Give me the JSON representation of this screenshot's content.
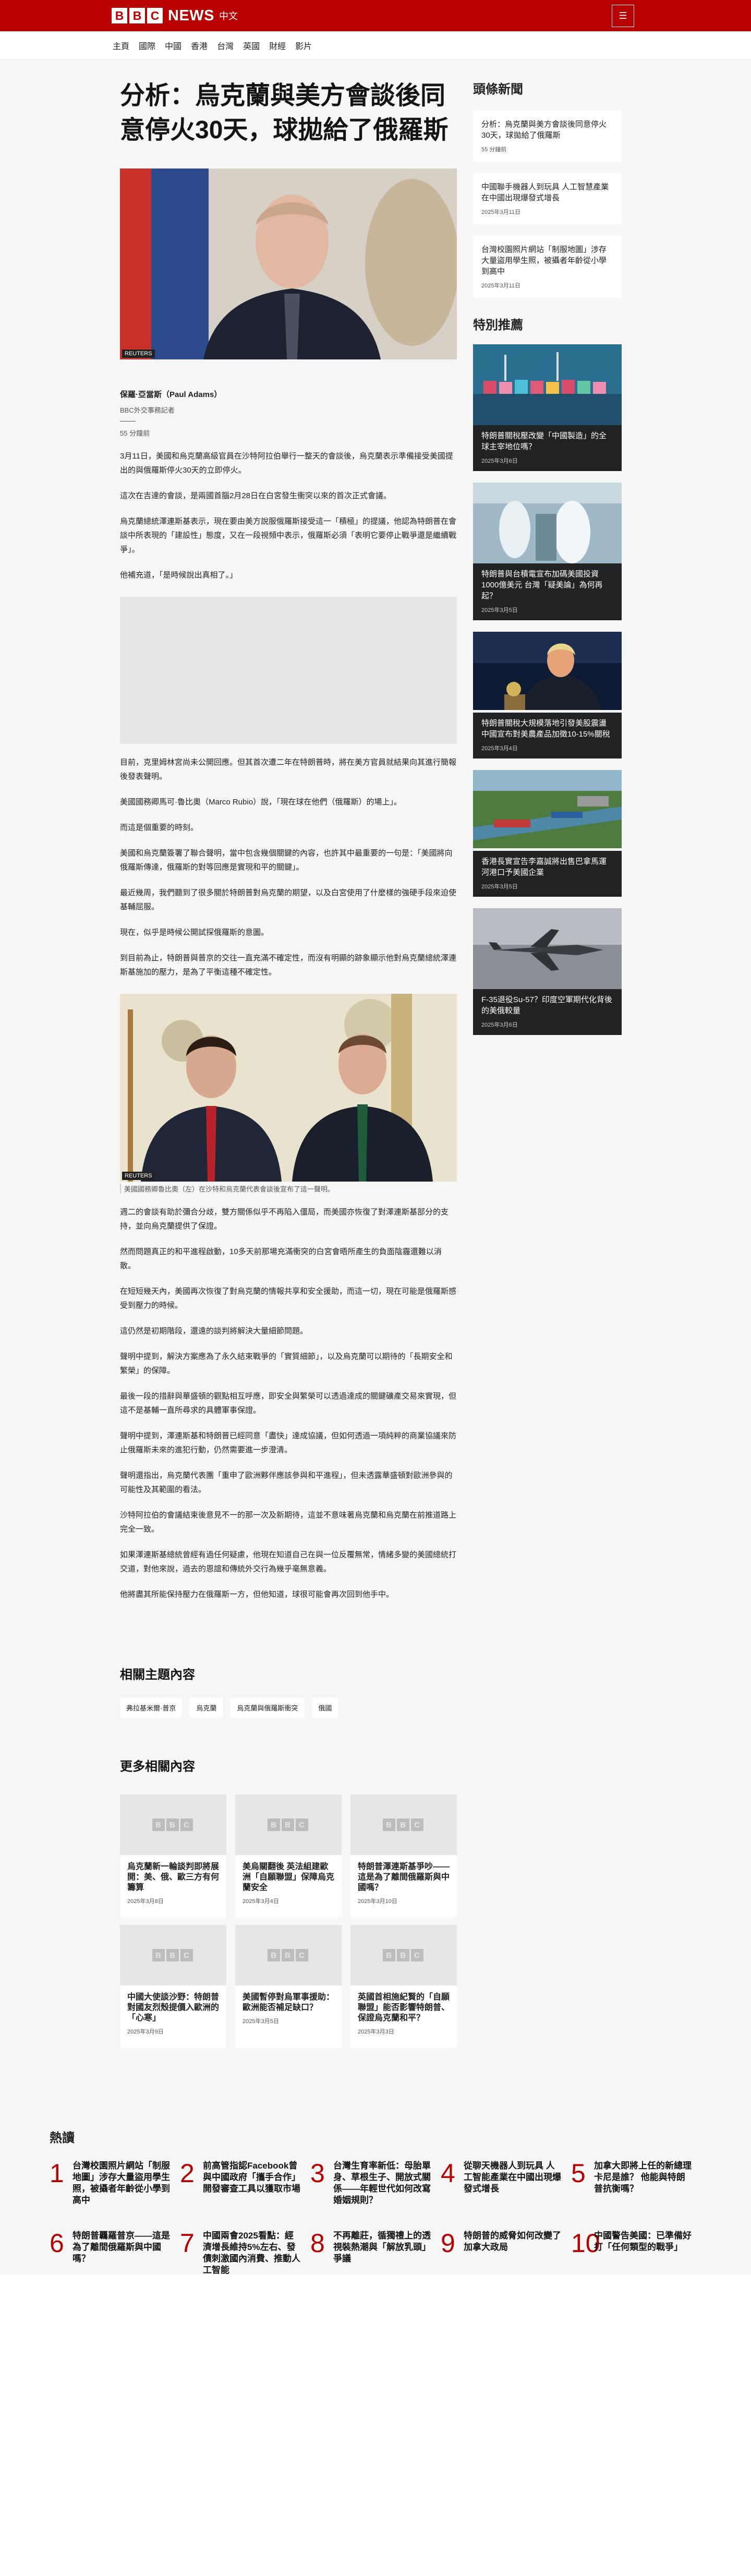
{
  "header": {
    "logo_letters": [
      "B",
      "B",
      "C"
    ],
    "logo_text": "NEWS",
    "logo_lang": "中文",
    "menu_icon": "hamburger-icon"
  },
  "nav": [
    "主頁",
    "國際",
    "中國",
    "香港",
    "台灣",
    "英國",
    "財經",
    "影片"
  ],
  "article": {
    "headline": "分析：烏克蘭與美方會談後同意停火30天，球拋給了俄羅斯",
    "hero_credit": "REUTERS",
    "author": "保羅·亞當斯（Paul Adams）",
    "author_role": "BBC外交事務記者",
    "read_time": "55 分鐘前",
    "paras_a": [
      "3月11日，美國和烏克蘭高級官員在沙特阿拉伯舉行一整天的會談後，烏克蘭表示準備接受美國提出的與俄羅斯停火30天的立即停火。",
      "這次在吉達的會談，是兩國首腦2月28日在白宮發生衝突以來的首次正式會議。",
      "烏克蘭總統澤連斯基表示，現在要由美方說服俄羅斯接受這一「積極」的提議，他認為特朗普在會談中所表現的「建設性」態度，又在一段視頻中表示，俄羅斯必須「表明它要停止戰爭還是繼續戰爭」。",
      "他補充道，「是時候說出真相了。」"
    ],
    "paras_b": [
      "目前，克里姆林宮尚未公開回應。但其首次遭二年在特朗普時，將在美方官員就結果向其進行簡報後發表聲明。",
      "美國國務卿馬可·魯比奧（Marco Rubio）說，「現在球在他們（俄羅斯）的場上」。",
      "而這是個重要的時刻。",
      "美國和烏克蘭簽署了聯合聲明，當中包含幾個關鍵的內容，也許其中最重要的一句是：「美國將向俄羅斯傳達，俄羅斯的對等回應是實現和平的關鍵」。",
      "最近幾周，我們聽到了很多關於特朗普對烏克蘭的期望，以及白宮使用了什麼樣的強硬手段來迫使基輔屈服。",
      "現在，似乎是時候公開試探俄羅斯的意圖。",
      "到目前為止，特朗普與普京的交往一直充滿不確定性，而沒有明顯的跡象顯示他對烏克蘭總統澤連斯基施加的壓力，是為了平衡這種不確定性。"
    ],
    "img2_credit": "REUTERS",
    "img2_caption": "美國國務卿魯比奧（左）在沙特和烏克蘭代表會談後宣布了這一聲明。",
    "paras_c": [
      "週二的會談有助於彌合分歧，雙方關係似乎不再陷入僵局，而美國亦恢復了對澤連斯基部分的支持，並向烏克蘭提供了保證。",
      "然而問題真正的和平進程啟動，10多天前那場充滿衝突的白宮會晤所產生的負面陰霾還難以消散。",
      "在短短幾天內，美國再次恢復了對烏克蘭的情報共享和安全援助，而這一切，現在可能是俄羅斯感受到壓力的時候。",
      "這仍然是初期階段，還遠的談判將解決大量細節問題。",
      "聲明中提到，解決方案應為了永久結束戰爭的「實質細節」，以及烏克蘭可以期待的「長期安全和繁榮」的保障。",
      "最後一段的措辭與華盛頓的觀點相互呼應，即安全與繁榮可以透過達成的關鍵礦產交易來實現，但這不是基輔一直所尋求的具體軍事保證。",
      "聲明中提到，澤連斯基和特朗普已經同意「盡快」達成協議，但如何透過一項純粹的商業協議來防止俄羅斯未來的進犯行動，仍然需要進一步澄清。",
      "聲明還指出，烏克蘭代表團「重申了歐洲夥伴應該參與和平進程」，但未透露華盛頓對歐洲參與的可能性及其範圍的看法。",
      "沙特阿拉伯的會議結束後意見不一的那一次及新期待，這並不意味著烏克蘭和烏克蘭在前推道路上完全一致。",
      "如果澤連斯基總統曾經有過任何疑慮，他現在知道自己在與一位反覆無常，情緒多變的美國總統打交道，對他來說，過去的恩誼和傳統外交行為幾乎毫無意義。",
      "他將盡其所能保持壓力在俄羅斯一方，但他知道，球很可能會再次回到他手中。"
    ]
  },
  "related_topics": {
    "heading": "相關主題內容",
    "tags": [
      "弗拉基米爾·普京",
      "烏克蘭",
      "烏克蘭與俄羅斯衝突",
      "俄國"
    ]
  },
  "more_related": {
    "heading": "更多相關內容",
    "placeholder_letters": [
      "B",
      "B",
      "C"
    ],
    "cards": [
      {
        "title": "烏克蘭新一輪談判即將展開：美、俄、歐三方有何籌算",
        "date": "2025年3月8日"
      },
      {
        "title": "美烏關翻後 英法組建歐洲「自願聯盟」保障烏克蘭安全",
        "date": "2025年3月4日"
      },
      {
        "title": "特朗普澤連斯基爭吵——這是為了離間俄羅斯與中國嗎？",
        "date": "2025年3月10日"
      },
      {
        "title": "中國大使談沙野：特朗普對國友烈殼提價入歐洲的「心寒」",
        "date": "2025年3月9日"
      },
      {
        "title": "美國暫停對烏軍事援助：歐洲能否補足缺口？",
        "date": "2025年3月5日"
      },
      {
        "title": "英國首相施紀賢的「自願聯盟」能否影響特朗普、保證烏克蘭和平？",
        "date": "2025年3月3日"
      }
    ]
  },
  "sidebar": {
    "headlines_heading": "頭條新聞",
    "headlines": [
      {
        "title": "分析：烏克蘭與美方會談後同意停火30天，球拋給了俄羅斯",
        "date": "55 分鐘前"
      },
      {
        "title": "中國聯手機器人到玩具 人工智慧產業在中國出現爆發式增長",
        "date": "2025年3月11日"
      },
      {
        "title": "台灣校園照片網站「制服地圖」涉存大量盜用學生照，被攝者年齡從小學到高中",
        "date": "2025年3月11日"
      }
    ],
    "featured_heading": "特別推薦",
    "featured": [
      {
        "title": "特朗普關稅壓改變「中國製造」的全球主宰地位嗎？",
        "date": "2025年3月6日"
      },
      {
        "title": "特朗普與台積電宣布加碼美國投資1000億美元 台灣「疑美論」為何再起？",
        "date": "2025年3月5日"
      },
      {
        "title": "特朗普關稅大規模落地引發美股震盪 中國宣布對美農產品加徵10-15%關稅",
        "date": "2025年3月4日"
      },
      {
        "title": "香港長實宣告李嘉誠將出售巴拿馬運河港口予美國企業",
        "date": "2025年3月5日"
      },
      {
        "title": "F-35退役Su-57？印度空軍期代化背後的美俄較量",
        "date": "2025年3月6日"
      }
    ]
  },
  "popular": {
    "heading": "熱讀",
    "items": [
      {
        "num": "1",
        "title": "台灣校園照片網站「制服地圖」涉存大量盜用學生照，被攝者年齡從小學到高中"
      },
      {
        "num": "2",
        "title": "前高管指認Facebook曾與中國政府「攜手合作」開發審查工具以獲取市場"
      },
      {
        "num": "3",
        "title": "台灣生育率新低：母胎單身、草根生子、開放式關係——年輕世代如何改寫婚姻規則？"
      },
      {
        "num": "4",
        "title": "從聊天機器人到玩具 人工智能產業在中國出現爆發式增長"
      },
      {
        "num": "5",
        "title": "加拿大即將上任的新總理卡尼是誰？ 他能與特朗普抗衡嗎？"
      },
      {
        "num": "6",
        "title": "特朗普覊羅普京——這是為了離間俄羅斯與中國嗎？"
      },
      {
        "num": "7",
        "title": "中國兩會2025看點：經濟增長維持5%左右、發債刺激國內消費、推動人工智能"
      },
      {
        "num": "8",
        "title": "不再離莊，循獨禮上的透視裝熱潮與「解放乳頭」爭議"
      },
      {
        "num": "9",
        "title": "特朗普的威脅如何改變了加拿大政局"
      },
      {
        "num": "10",
        "title": "中國警告美國：已準備好打「任何類型的戰爭」"
      }
    ]
  },
  "colors": {
    "brand": "#b80000",
    "text": "#202224",
    "grey_bg": "#f6f6f6"
  }
}
